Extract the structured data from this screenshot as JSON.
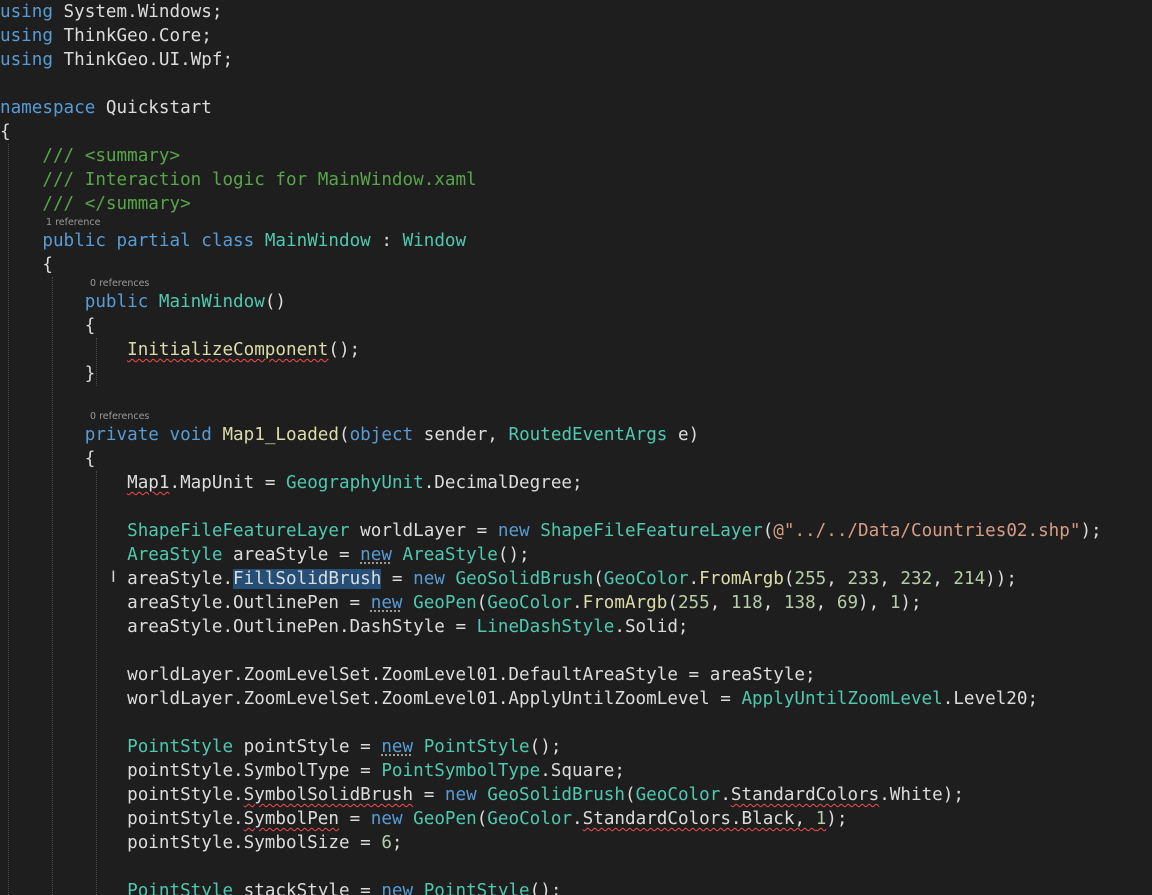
{
  "editor": {
    "code_lens": {
      "class_refs": "1 reference",
      "ctor_refs": "0 references",
      "method_refs": "0 references"
    },
    "colors": {
      "background": "#1e1e1e",
      "keyword": "#569cd6",
      "type": "#4ec9b0",
      "method": "#dcdcaa",
      "comment": "#57a64a",
      "string": "#d69d85",
      "number": "#b5cea8",
      "selection": "#264f78"
    },
    "mouse_cursor_icon": "text-ibeam-icon",
    "lines": [
      {
        "tokens": [
          {
            "t": "using",
            "c": "kw"
          },
          {
            "t": " System.Windows;",
            "c": "tx"
          }
        ]
      },
      {
        "tokens": [
          {
            "t": "using",
            "c": "kw"
          },
          {
            "t": " ThinkGeo.Core;",
            "c": "tx"
          }
        ]
      },
      {
        "tokens": [
          {
            "t": "using",
            "c": "kw"
          },
          {
            "t": " ThinkGeo.UI.Wpf;",
            "c": "tx"
          }
        ]
      },
      {
        "tokens": []
      },
      {
        "tokens": [
          {
            "t": "namespace",
            "c": "kw"
          },
          {
            "t": " Quickstart",
            "c": "tx"
          }
        ]
      },
      {
        "tokens": [
          {
            "t": "{",
            "c": "tx"
          }
        ]
      },
      {
        "tokens": [
          {
            "t": "    /// <summary>",
            "c": "cm"
          }
        ]
      },
      {
        "tokens": [
          {
            "t": "    /// Interaction logic for MainWindow.xaml",
            "c": "cm"
          }
        ]
      },
      {
        "tokens": [
          {
            "t": "    /// </summary>",
            "c": "cm"
          }
        ]
      },
      {
        "tokens": [
          {
            "t": "    ",
            "c": "tx"
          },
          {
            "t": "public",
            "c": "kw"
          },
          {
            "t": " ",
            "c": "tx"
          },
          {
            "t": "partial",
            "c": "kw"
          },
          {
            "t": " ",
            "c": "tx"
          },
          {
            "t": "class",
            "c": "kw"
          },
          {
            "t": " ",
            "c": "tx"
          },
          {
            "t": "MainWindow",
            "c": "ty"
          },
          {
            "t": " : ",
            "c": "tx"
          },
          {
            "t": "Window",
            "c": "ty"
          }
        ]
      },
      {
        "tokens": [
          {
            "t": "    {",
            "c": "tx"
          }
        ]
      },
      {
        "tokens": [
          {
            "t": "        ",
            "c": "tx"
          },
          {
            "t": "public",
            "c": "kw"
          },
          {
            "t": " ",
            "c": "tx"
          },
          {
            "t": "MainWindow",
            "c": "ty"
          },
          {
            "t": "()",
            "c": "tx"
          }
        ]
      },
      {
        "tokens": [
          {
            "t": "        {",
            "c": "tx"
          }
        ]
      },
      {
        "tokens": [
          {
            "t": "            ",
            "c": "tx"
          },
          {
            "t": "InitializeComponent",
            "c": "fn",
            "u": "squig"
          },
          {
            "t": "();",
            "c": "tx"
          }
        ]
      },
      {
        "tokens": [
          {
            "t": "        }",
            "c": "tx"
          }
        ]
      },
      {
        "tokens": []
      },
      {
        "tokens": [
          {
            "t": "        ",
            "c": "tx"
          },
          {
            "t": "private",
            "c": "kw"
          },
          {
            "t": " ",
            "c": "tx"
          },
          {
            "t": "void",
            "c": "kw"
          },
          {
            "t": " ",
            "c": "tx"
          },
          {
            "t": "Map1_Loaded",
            "c": "fn"
          },
          {
            "t": "(",
            "c": "tx"
          },
          {
            "t": "object",
            "c": "kw"
          },
          {
            "t": " sender, ",
            "c": "tx"
          },
          {
            "t": "RoutedEventArgs",
            "c": "ty"
          },
          {
            "t": " e)",
            "c": "tx"
          }
        ]
      },
      {
        "tokens": [
          {
            "t": "        {",
            "c": "tx"
          }
        ]
      },
      {
        "tokens": [
          {
            "t": "            ",
            "c": "tx"
          },
          {
            "t": "Map1",
            "c": "tx",
            "u": "squig"
          },
          {
            "t": ".MapUnit = ",
            "c": "tx"
          },
          {
            "t": "GeographyUnit",
            "c": "ty"
          },
          {
            "t": ".DecimalDegree;",
            "c": "tx"
          }
        ]
      },
      {
        "tokens": []
      },
      {
        "tokens": [
          {
            "t": "            ",
            "c": "tx"
          },
          {
            "t": "ShapeFileFeatureLayer",
            "c": "ty"
          },
          {
            "t": " worldLayer = ",
            "c": "tx"
          },
          {
            "t": "new",
            "c": "kw"
          },
          {
            "t": " ",
            "c": "tx"
          },
          {
            "t": "ShapeFileFeatureLayer",
            "c": "ty"
          },
          {
            "t": "(",
            "c": "tx"
          },
          {
            "t": "@\"../../Data/Countries02.shp\"",
            "c": "st"
          },
          {
            "t": ");",
            "c": "tx"
          }
        ]
      },
      {
        "tokens": [
          {
            "t": "            ",
            "c": "tx"
          },
          {
            "t": "AreaStyle",
            "c": "ty"
          },
          {
            "t": " areaStyle = ",
            "c": "tx"
          },
          {
            "t": "new",
            "c": "kw",
            "u": "dots"
          },
          {
            "t": " ",
            "c": "tx"
          },
          {
            "t": "AreaStyle",
            "c": "ty"
          },
          {
            "t": "();",
            "c": "tx"
          }
        ]
      },
      {
        "tokens": [
          {
            "t": "            ",
            "c": "tx"
          },
          {
            "t": "areaStyle.",
            "c": "tx"
          },
          {
            "t": "FillSolidBrush",
            "c": "tx",
            "u": "sel"
          },
          {
            "t": " = ",
            "c": "tx"
          },
          {
            "t": "new",
            "c": "kw"
          },
          {
            "t": " ",
            "c": "tx"
          },
          {
            "t": "GeoSolidBrush",
            "c": "ty"
          },
          {
            "t": "(",
            "c": "tx"
          },
          {
            "t": "GeoColor",
            "c": "ty"
          },
          {
            "t": ".",
            "c": "tx"
          },
          {
            "t": "FromArgb",
            "c": "fn"
          },
          {
            "t": "(",
            "c": "tx"
          },
          {
            "t": "255",
            "c": "nm"
          },
          {
            "t": ", ",
            "c": "tx"
          },
          {
            "t": "233",
            "c": "nm"
          },
          {
            "t": ", ",
            "c": "tx"
          },
          {
            "t": "232",
            "c": "nm"
          },
          {
            "t": ", ",
            "c": "tx"
          },
          {
            "t": "214",
            "c": "nm"
          },
          {
            "t": "));",
            "c": "tx"
          }
        ]
      },
      {
        "tokens": [
          {
            "t": "            ",
            "c": "tx"
          },
          {
            "t": "areaStyle.OutlinePen = ",
            "c": "tx"
          },
          {
            "t": "new",
            "c": "kw",
            "u": "dots"
          },
          {
            "t": " ",
            "c": "tx"
          },
          {
            "t": "GeoPen",
            "c": "ty"
          },
          {
            "t": "(",
            "c": "tx"
          },
          {
            "t": "GeoColor",
            "c": "ty"
          },
          {
            "t": ".",
            "c": "tx"
          },
          {
            "t": "FromArgb",
            "c": "fn"
          },
          {
            "t": "(",
            "c": "tx"
          },
          {
            "t": "255",
            "c": "nm"
          },
          {
            "t": ", ",
            "c": "tx"
          },
          {
            "t": "118",
            "c": "nm"
          },
          {
            "t": ", ",
            "c": "tx"
          },
          {
            "t": "138",
            "c": "nm"
          },
          {
            "t": ", ",
            "c": "tx"
          },
          {
            "t": "69",
            "c": "nm"
          },
          {
            "t": "), ",
            "c": "tx"
          },
          {
            "t": "1",
            "c": "nm"
          },
          {
            "t": ");",
            "c": "tx"
          }
        ]
      },
      {
        "tokens": [
          {
            "t": "            ",
            "c": "tx"
          },
          {
            "t": "areaStyle.OutlinePen.DashStyle = ",
            "c": "tx"
          },
          {
            "t": "LineDashStyle",
            "c": "ty"
          },
          {
            "t": ".Solid;",
            "c": "tx"
          }
        ]
      },
      {
        "tokens": []
      },
      {
        "tokens": [
          {
            "t": "            ",
            "c": "tx"
          },
          {
            "t": "worldLayer.ZoomLevelSet.ZoomLevel01.DefaultAreaStyle = areaStyle;",
            "c": "tx"
          }
        ]
      },
      {
        "tokens": [
          {
            "t": "            ",
            "c": "tx"
          },
          {
            "t": "worldLayer.ZoomLevelSet.ZoomLevel01.ApplyUntilZoomLevel = ",
            "c": "tx"
          },
          {
            "t": "ApplyUntilZoomLevel",
            "c": "ty"
          },
          {
            "t": ".Level20;",
            "c": "tx"
          }
        ]
      },
      {
        "tokens": []
      },
      {
        "tokens": [
          {
            "t": "            ",
            "c": "tx"
          },
          {
            "t": "PointStyle",
            "c": "ty"
          },
          {
            "t": " pointStyle = ",
            "c": "tx"
          },
          {
            "t": "new",
            "c": "kw",
            "u": "dots"
          },
          {
            "t": " ",
            "c": "tx"
          },
          {
            "t": "PointStyle",
            "c": "ty"
          },
          {
            "t": "();",
            "c": "tx"
          }
        ]
      },
      {
        "tokens": [
          {
            "t": "            ",
            "c": "tx"
          },
          {
            "t": "pointStyle.SymbolType = ",
            "c": "tx"
          },
          {
            "t": "PointSymbolType",
            "c": "ty"
          },
          {
            "t": ".Square;",
            "c": "tx"
          }
        ]
      },
      {
        "tokens": [
          {
            "t": "            ",
            "c": "tx"
          },
          {
            "t": "pointStyle.",
            "c": "tx"
          },
          {
            "t": "SymbolSolidBrush",
            "c": "tx",
            "u": "squig"
          },
          {
            "t": " = ",
            "c": "tx"
          },
          {
            "t": "new",
            "c": "kw"
          },
          {
            "t": " ",
            "c": "tx"
          },
          {
            "t": "GeoSolidBrush",
            "c": "ty"
          },
          {
            "t": "(",
            "c": "tx"
          },
          {
            "t": "GeoColor",
            "c": "ty"
          },
          {
            "t": ".",
            "c": "tx"
          },
          {
            "t": "StandardColors",
            "c": "tx",
            "u": "squig"
          },
          {
            "t": ".White);",
            "c": "tx"
          }
        ]
      },
      {
        "tokens": [
          {
            "t": "            ",
            "c": "tx"
          },
          {
            "t": "pointStyle.",
            "c": "tx"
          },
          {
            "t": "SymbolPen",
            "c": "tx",
            "u": "squig"
          },
          {
            "t": " = ",
            "c": "tx"
          },
          {
            "t": "new",
            "c": "kw"
          },
          {
            "t": " ",
            "c": "tx"
          },
          {
            "t": "GeoPen",
            "c": "ty"
          },
          {
            "t": "(",
            "c": "tx"
          },
          {
            "t": "GeoColor",
            "c": "ty"
          },
          {
            "t": ".",
            "c": "tx"
          },
          {
            "t": "StandardColors.Black, ",
            "c": "tx",
            "u": "squig"
          },
          {
            "t": "1",
            "c": "nm",
            "u": "squig"
          },
          {
            "t": ");",
            "c": "tx"
          }
        ]
      },
      {
        "tokens": [
          {
            "t": "            ",
            "c": "tx"
          },
          {
            "t": "pointStyle.SymbolSize = ",
            "c": "tx"
          },
          {
            "t": "6",
            "c": "nm"
          },
          {
            "t": ";",
            "c": "tx"
          }
        ]
      },
      {
        "tokens": []
      },
      {
        "tokens": [
          {
            "t": "            ",
            "c": "tx"
          },
          {
            "t": "PointStyle",
            "c": "ty"
          },
          {
            "t": " stackStyle = ",
            "c": "tx"
          },
          {
            "t": "new",
            "c": "kw"
          },
          {
            "t": " ",
            "c": "tx"
          },
          {
            "t": "PointStyle",
            "c": "ty"
          },
          {
            "t": "();",
            "c": "tx"
          }
        ]
      }
    ]
  }
}
